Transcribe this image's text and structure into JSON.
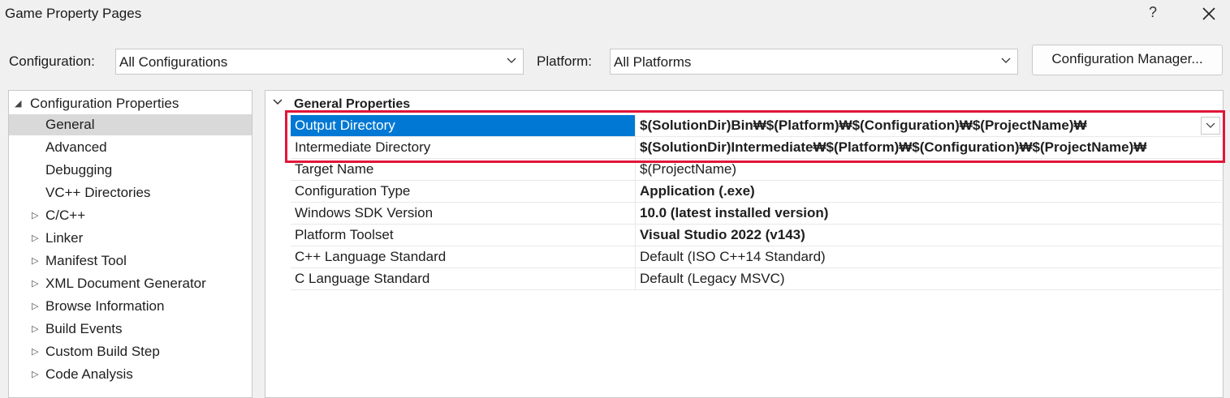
{
  "window": {
    "title": "Game Property Pages",
    "help_label": "?",
    "close_icon": "close-icon"
  },
  "toolbar": {
    "configuration_label": "Configuration:",
    "configuration_value": "All Configurations",
    "platform_label": "Platform:",
    "platform_value": "All Platforms",
    "manager_button": "Configuration Manager..."
  },
  "tree": {
    "root": {
      "label": "Configuration Properties",
      "expanded": true
    },
    "items": [
      {
        "label": "General",
        "expandable": false,
        "selected": true
      },
      {
        "label": "Advanced",
        "expandable": false
      },
      {
        "label": "Debugging",
        "expandable": false
      },
      {
        "label": "VC++ Directories",
        "expandable": false
      },
      {
        "label": "C/C++",
        "expandable": true
      },
      {
        "label": "Linker",
        "expandable": true
      },
      {
        "label": "Manifest Tool",
        "expandable": true
      },
      {
        "label": "XML Document Generator",
        "expandable": true
      },
      {
        "label": "Browse Information",
        "expandable": true
      },
      {
        "label": "Build Events",
        "expandable": true
      },
      {
        "label": "Custom Build Step",
        "expandable": true
      },
      {
        "label": "Code Analysis",
        "expandable": true
      }
    ]
  },
  "grid": {
    "category": "General Properties",
    "properties": [
      {
        "name": "Output Directory",
        "value": "$(SolutionDir)Bin₩$(Platform)₩$(Configuration)₩$(ProjectName)₩",
        "bold": true,
        "selected": true
      },
      {
        "name": "Intermediate Directory",
        "value": "$(SolutionDir)Intermediate₩$(Platform)₩$(Configuration)₩$(ProjectName)₩",
        "bold": true
      },
      {
        "name": "Target Name",
        "value": "$(ProjectName)",
        "bold": false
      },
      {
        "name": "Configuration Type",
        "value": "Application (.exe)",
        "bold": true
      },
      {
        "name": "Windows SDK Version",
        "value": "10.0 (latest installed version)",
        "bold": true
      },
      {
        "name": "Platform Toolset",
        "value": "Visual Studio 2022 (v143)",
        "bold": true
      },
      {
        "name": "C++ Language Standard",
        "value": "Default (ISO C++14 Standard)",
        "bold": false
      },
      {
        "name": "C Language Standard",
        "value": "Default (Legacy MSVC)",
        "bold": false
      }
    ]
  },
  "colors": {
    "selection": "#0078d4",
    "highlight_box": "#e0163a",
    "tree_selection": "#d9d9d9"
  }
}
